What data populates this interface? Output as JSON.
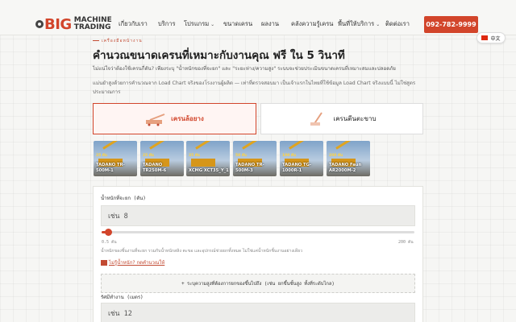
{
  "header": {
    "logo": {
      "big": "BIG",
      "line1": "MACHINE",
      "line2": "TRADING"
    },
    "nav": [
      {
        "label": "เกี่ยวกับเรา",
        "dropdown": false
      },
      {
        "label": "บริการ",
        "dropdown": false
      },
      {
        "label": "โปรแกรม",
        "dropdown": true
      },
      {
        "label": "ขนาดเครน",
        "dropdown": false
      },
      {
        "label": "ผลงาน",
        "dropdown": false
      },
      {
        "label": "คลังความรู้เครน",
        "dropdown": false
      },
      {
        "label": "พื้นที่ให้บริการ",
        "dropdown": true
      },
      {
        "label": "ติดต่อเรา",
        "dropdown": false
      }
    ],
    "phone": "092-782-9999",
    "lang": "中文"
  },
  "main": {
    "eyebrow": "เครื่องมือหน้างาน",
    "title": "คำนวณขนาดเครนที่เหมาะกับงานคุณ ฟรี ใน 5 วินาที",
    "intro": "ไม่แน่ใจว่าต้องใช้เครนกี่ตัน? เพียงระบุ \"น้ำหนักของที่จะยก\" และ \"ระยะห่าง/ความสูง\" ระบบจะช่วยประเมินขนาดเครนที่เหมาะสมและปลอดภัย",
    "note": "แม่นยำสูงด้วยการคำนวณจาก Load Chart จริงของโรงงานผู้ผลิต — เท่าที่ตรวจสอบมา เป็นเจ้าแรกในไทยที่ใช้ข้อมูล Load Chart จริงแบบนี้ ไม่ใช่สูตรประมาณการ",
    "crane_types": [
      {
        "label": "เครนล้อยาง",
        "active": true
      },
      {
        "label": "เครนตีนตะขาบ",
        "active": false
      }
    ],
    "models": [
      {
        "badge": "25 ตัน",
        "name": "TADANO TR-\n500M-1"
      },
      {
        "badge": "25 ตัน",
        "name": "TADANO\nTR250M-6"
      },
      {
        "badge": "35 ตัน",
        "name": "XCMG XCT35_Y_1"
      },
      {
        "badge": "50 ตัน",
        "name": "TADANO TR-\n500M-3"
      },
      {
        "badge": "100 ตัน",
        "name": "TADANO TG-\n1000R-1"
      },
      {
        "badge": "200 ตัน",
        "name": "TADANO Faun\nAR2000M-2"
      }
    ],
    "form": {
      "weight_label": "น้ำหนักที่จะยก (ตัน)",
      "weight_placeholder": "เช่น 8",
      "slider_value": 4.5,
      "slider_min_label": "0.5 ตัน",
      "slider_max_label": "200 ตัน",
      "helper": "น้ำหนักของชิ้นงานที่จะยก รวมกับน้ำหนักสลิง ตะขอ และอุปกรณ์ช่วยยกทั้งหมด ไม่ใช่แค่น้ำหนักชิ้นงานอย่างเดียว",
      "link": "ไม่รู้น้ำหนัก? กดคำนวณให้",
      "advanced": "+ ระบุความสูงที่ต้องการยกของขึ้นไปถึง (เช่น ยกขึ้นชั้นสูง ทั้งที่ระดับไกล)",
      "radius_label": "รัศมีทำงาน (เมตร)",
      "radius_placeholder": "เช่น 12"
    }
  }
}
